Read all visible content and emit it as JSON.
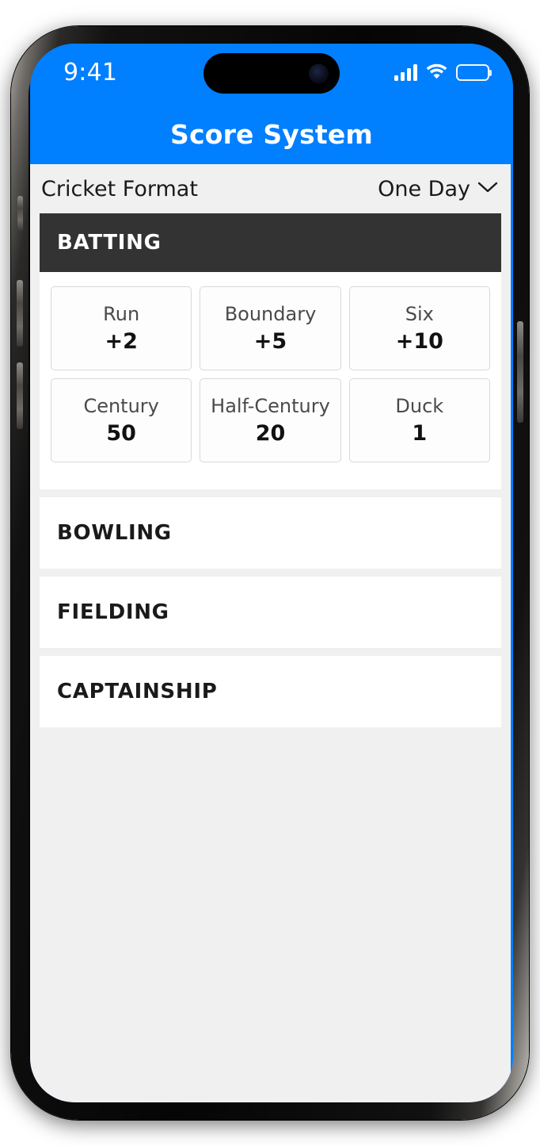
{
  "status_bar": {
    "time": "9:41",
    "cellular_icon": "cellular-bars-icon",
    "wifi_icon": "wifi-icon",
    "battery_icon": "battery-full-icon"
  },
  "nav": {
    "title": "Score System"
  },
  "format_row": {
    "label": "Cricket Format",
    "value": "One Day",
    "chevron_icon": "chevron-down-icon"
  },
  "sections": [
    {
      "title": "BATTING",
      "expanded": true,
      "rows": [
        [
          {
            "label": "Run",
            "value": "+2"
          },
          {
            "label": "Boundary",
            "value": "+5"
          },
          {
            "label": "Six",
            "value": "+10"
          }
        ],
        [
          {
            "label": "Century",
            "value": "50"
          },
          {
            "label": "Half-Century",
            "value": "20"
          },
          {
            "label": "Duck",
            "value": "1"
          }
        ]
      ]
    },
    {
      "title": "BOWLING",
      "expanded": false
    },
    {
      "title": "FIELDING",
      "expanded": false
    },
    {
      "title": "CAPTAINSHIP",
      "expanded": false
    }
  ],
  "colors": {
    "accent_blue": "#007fff",
    "header_dark": "#333333",
    "page_background": "#f0f0f0",
    "card_background": "#ffffff",
    "tile_border": "#d9d9d9"
  }
}
